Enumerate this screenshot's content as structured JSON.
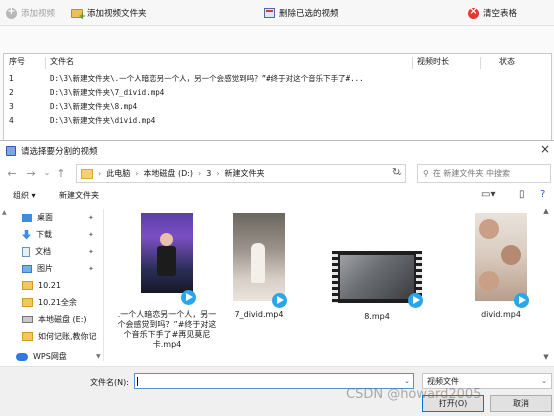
{
  "toolbar": {
    "add_video": "添加视频",
    "add_folder": "添加视频文件夹",
    "delete_selected": "删除已选的视频",
    "clear_table": "清空表格"
  },
  "grid": {
    "headers": [
      "序号",
      "文件名",
      "视频时长",
      "状态"
    ],
    "rows": [
      {
        "seq": "1",
        "name": "D:\\3\\新建文件夹\\.一个人暗恋另一个人，另一个会感觉到吗？”#终于对这个音乐下手了#..."
      },
      {
        "seq": "2",
        "name": "D:\\3\\新建文件夹\\7_divid.mp4"
      },
      {
        "seq": "3",
        "name": "D:\\3\\新建文件夹\\8.mp4"
      },
      {
        "seq": "4",
        "name": "D:\\3\\新建文件夹\\divid.mp4"
      }
    ]
  },
  "dialog": {
    "title": "请选择要分割的视频",
    "close": "×",
    "breadcrumb": [
      "此电脑",
      "本地磁盘 (D:)",
      "3",
      "新建文件夹"
    ],
    "search_placeholder": "在 新建文件夹 中搜索",
    "organize": "组织 ▾",
    "new_folder": "新建文件夹",
    "sidebar": [
      {
        "label": "桌面",
        "icon": "desktop-icon",
        "pinned": true
      },
      {
        "label": "下载",
        "icon": "download-icon",
        "pinned": true
      },
      {
        "label": "文档",
        "icon": "document-icon",
        "pinned": true
      },
      {
        "label": "图片",
        "icon": "picture-icon",
        "pinned": true
      },
      {
        "label": "10.21",
        "icon": "folder-icon",
        "pinned": false
      },
      {
        "label": "10.21全余",
        "icon": "folder-icon",
        "pinned": false
      },
      {
        "label": "本地磁盘 (E:)",
        "icon": "drive-icon",
        "pinned": false
      },
      {
        "label": "如何记账,教你记",
        "icon": "folder-icon",
        "pinned": false
      },
      {
        "label": "WPS网盘",
        "icon": "cloud-icon",
        "pinned": false
      }
    ],
    "files": [
      {
        "name": ".一个人暗恋另一个人，另一个会感觉到吗？”#终于对这个音乐下手了#再见莫尼卡.mp4"
      },
      {
        "name": "7_divid.mp4"
      },
      {
        "name": "8.mp4"
      },
      {
        "name": "divid.mp4"
      }
    ],
    "filename_label": "文件名(N):",
    "filename_value": "",
    "filetype": "视频文件",
    "open_button": "打开(O)",
    "cancel_button": "取消"
  },
  "watermark": "CSDN @howard2005"
}
